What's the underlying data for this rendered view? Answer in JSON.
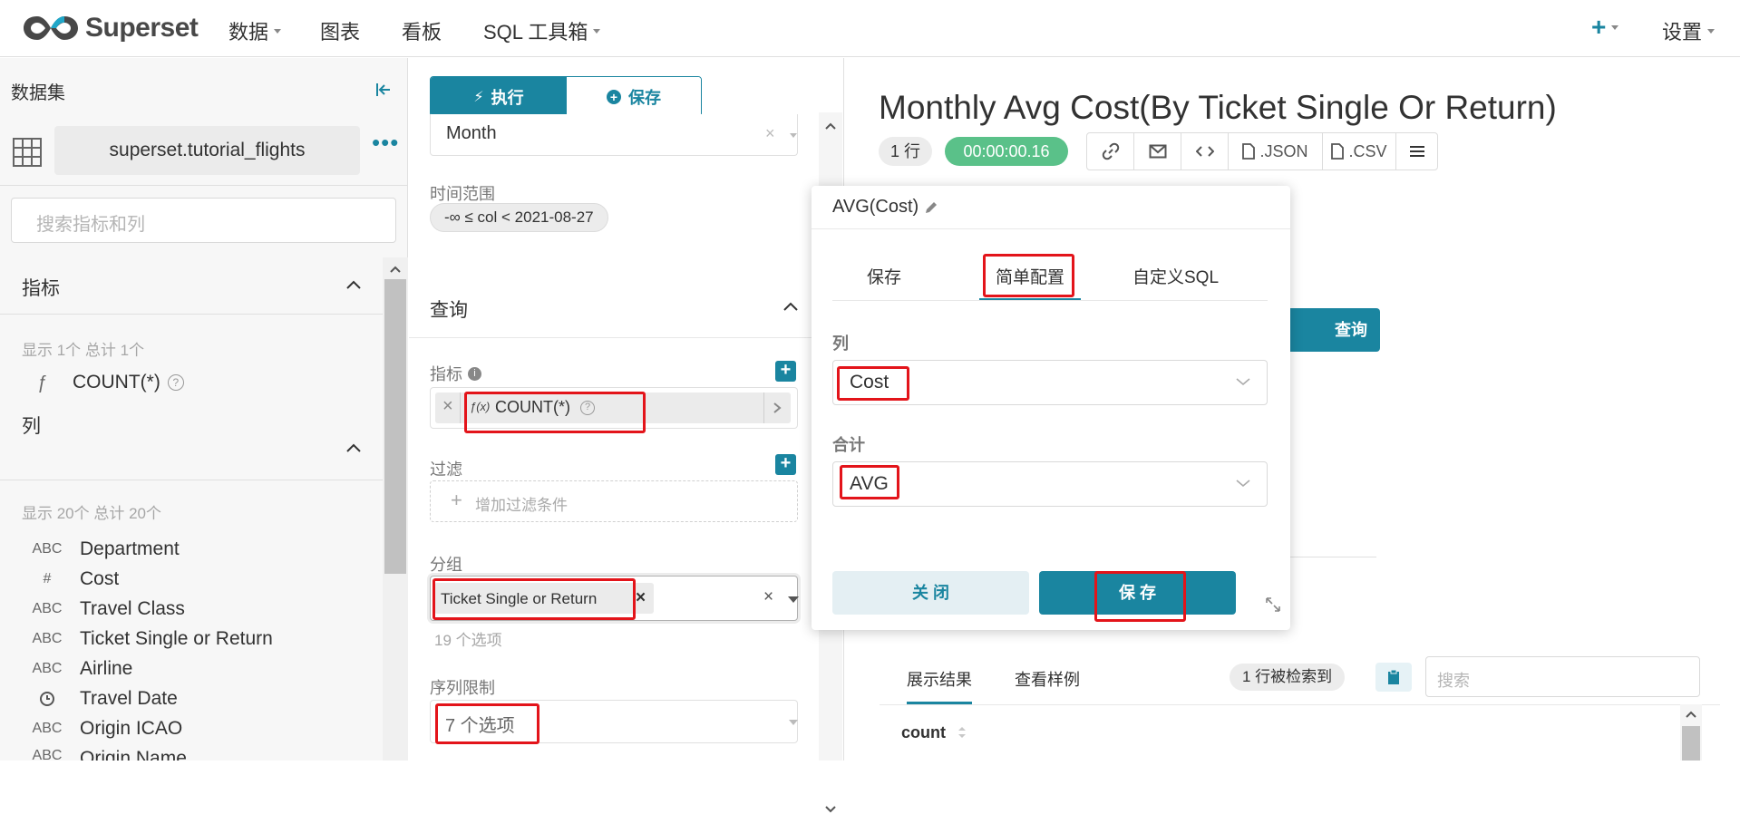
{
  "nav": {
    "brand": "Superset",
    "items": [
      {
        "label": "数据",
        "dropdown": true
      },
      {
        "label": "图表",
        "dropdown": false
      },
      {
        "label": "看板",
        "dropdown": false
      },
      {
        "label": "SQL 工具箱",
        "dropdown": true
      }
    ],
    "settings": "设置"
  },
  "left": {
    "title": "数据集",
    "dataset": "superset.tutorial_flights",
    "search_placeholder": "搜索指标和列",
    "metrics_section": "指标",
    "metrics_count": "显示 1个 总计 1个",
    "metric_items": [
      {
        "symbol": "ƒ",
        "label": "COUNT(*)"
      }
    ],
    "columns_section": "列",
    "columns_count": "显示 20个 总计 20个",
    "columns": [
      {
        "type": "ABC",
        "label": "Department"
      },
      {
        "type": "#",
        "label": "Cost"
      },
      {
        "type": "ABC",
        "label": "Travel Class"
      },
      {
        "type": "ABC",
        "label": "Ticket Single or Return"
      },
      {
        "type": "ABC",
        "label": "Airline"
      },
      {
        "type": "clock",
        "label": "Travel Date"
      },
      {
        "type": "ABC",
        "label": "Origin ICAO"
      },
      {
        "type": "ABC",
        "label": "Origin Name"
      }
    ]
  },
  "middle": {
    "run_label": "执行",
    "save_label": "保存",
    "time_grain_value": "Month",
    "time_range_label": "时间范围",
    "time_range_value": "-∞ ≤ col < 2021-08-27",
    "query_section": "查询",
    "metrics_label": "指标",
    "metric_chip": "COUNT(*)",
    "metric_fx": "ƒ(x)",
    "filters_label": "过滤",
    "add_filter": "增加过滤条件",
    "groupby_label": "分组",
    "groupby_chip": "Ticket Single or Return",
    "groupby_hint": "19 个选项",
    "series_limit_label": "序列限制",
    "series_limit_value": "7 个选项"
  },
  "right": {
    "chart_title": "Monthly Avg Cost(By Ticket Single Or Return)",
    "rows_badge": "1 行",
    "time_badge": "00:00:00.16",
    "json_label": ".JSON",
    "csv_label": ".CSV",
    "run_query_partial": "查询",
    "results_tab": "展示结果",
    "samples_tab": "查看样例",
    "rows_retrieved": "1 行被检索到",
    "search_placeholder": "搜索",
    "col_header": "count"
  },
  "popover": {
    "title": "AVG(Cost)",
    "tabs": [
      "保存",
      "简单配置",
      "自定义SQL"
    ],
    "column_label": "列",
    "column_value": "Cost",
    "aggregate_label": "合计",
    "aggregate_value": "AVG",
    "close_label": "关 闭",
    "save_label": "保 存"
  },
  "colors": {
    "primary": "#1a85a0",
    "success": "#5ac189",
    "highlight": "#e3141a"
  }
}
